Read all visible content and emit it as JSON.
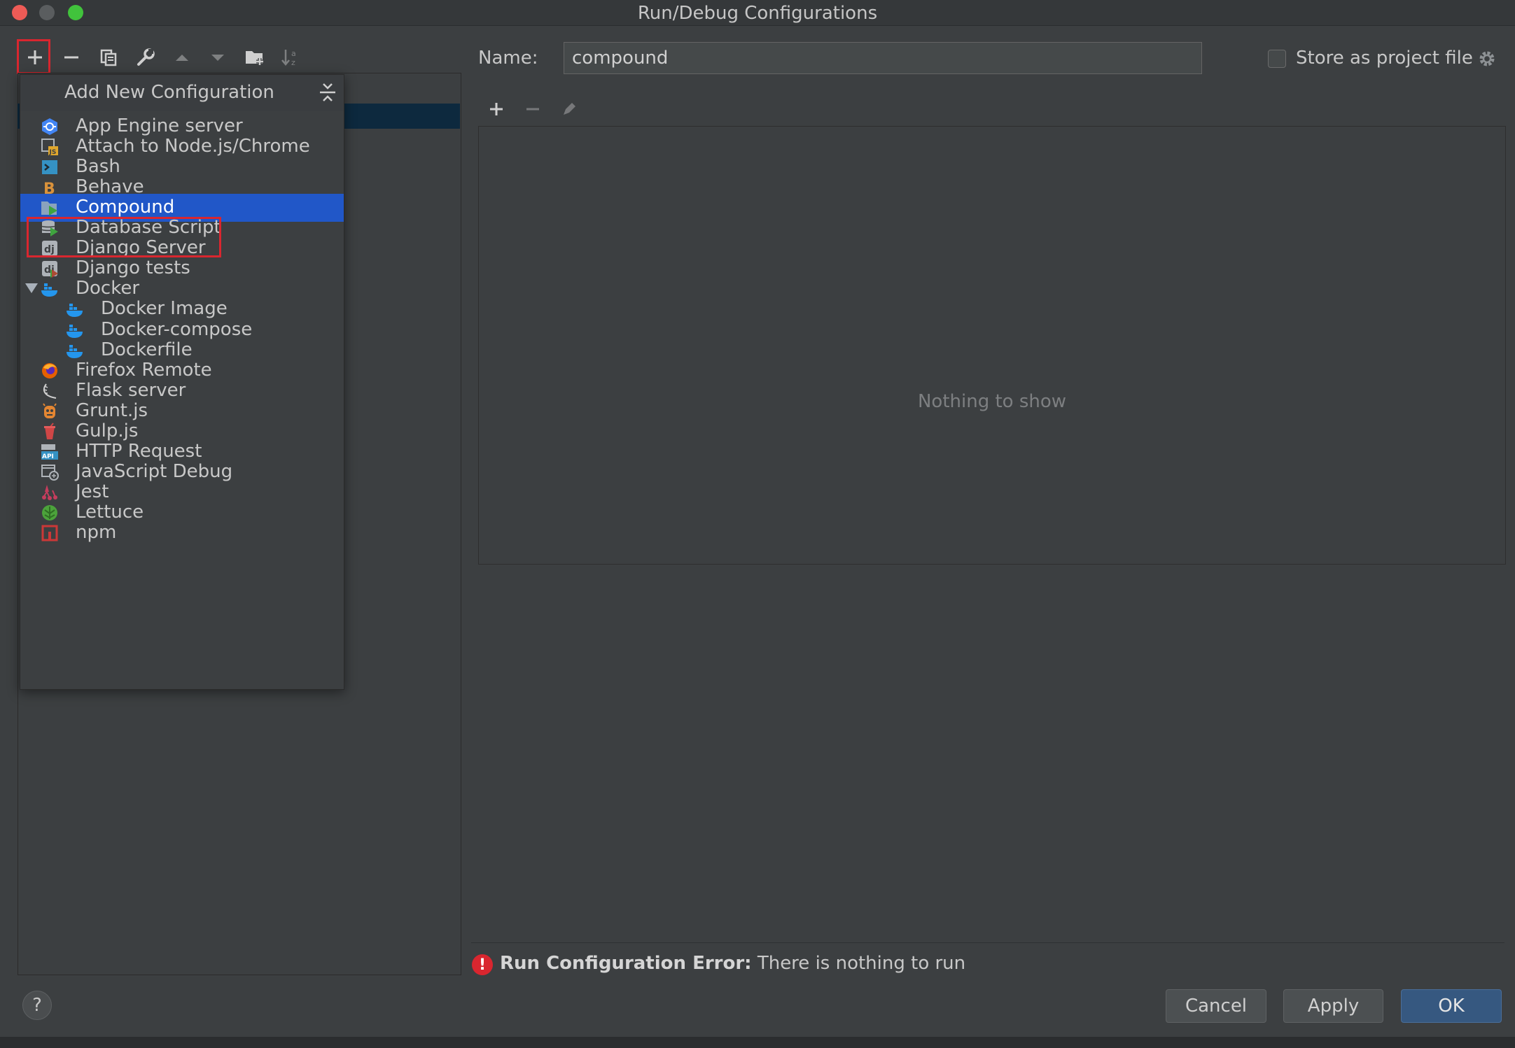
{
  "window": {
    "title": "Run/Debug Configurations"
  },
  "toolbar": {
    "icons": [
      "add-icon",
      "remove-icon",
      "copy-icon",
      "wrench-icon",
      "move-up-icon",
      "move-down-icon",
      "new-folder-icon",
      "sort-icon"
    ]
  },
  "popup": {
    "title": "Add New Configuration",
    "items": [
      {
        "label": "App Engine server",
        "icon": "app-engine-icon",
        "indent": 0
      },
      {
        "label": "Attach to Node.js/Chrome",
        "icon": "nodejs-attach-icon",
        "indent": 0
      },
      {
        "label": "Bash",
        "icon": "bash-icon",
        "indent": 0
      },
      {
        "label": "Behave",
        "icon": "behave-icon",
        "indent": 0
      },
      {
        "label": "Compound",
        "icon": "compound-icon",
        "indent": 0,
        "selected": true
      },
      {
        "label": "Database Script",
        "icon": "database-script-icon",
        "indent": 0
      },
      {
        "label": "Django Server",
        "icon": "django-icon",
        "indent": 0
      },
      {
        "label": "Django tests",
        "icon": "django-tests-icon",
        "indent": 0
      },
      {
        "label": "Docker",
        "icon": "docker-icon",
        "indent": 0,
        "expanded": true
      },
      {
        "label": "Docker Image",
        "icon": "docker-icon",
        "indent": 1
      },
      {
        "label": "Docker-compose",
        "icon": "docker-icon",
        "indent": 1
      },
      {
        "label": "Dockerfile",
        "icon": "docker-icon",
        "indent": 1
      },
      {
        "label": "Firefox Remote",
        "icon": "firefox-icon",
        "indent": 0
      },
      {
        "label": "Flask server",
        "icon": "flask-icon",
        "indent": 0
      },
      {
        "label": "Grunt.js",
        "icon": "grunt-icon",
        "indent": 0
      },
      {
        "label": "Gulp.js",
        "icon": "gulp-icon",
        "indent": 0
      },
      {
        "label": "HTTP Request",
        "icon": "http-request-icon",
        "indent": 0
      },
      {
        "label": "JavaScript Debug",
        "icon": "javascript-debug-icon",
        "indent": 0
      },
      {
        "label": "Jest",
        "icon": "jest-icon",
        "indent": 0
      },
      {
        "label": "Lettuce",
        "icon": "lettuce-icon",
        "indent": 0
      },
      {
        "label": "npm",
        "icon": "npm-icon",
        "indent": 0
      }
    ]
  },
  "form": {
    "name_label": "Name:",
    "name_value": "compound",
    "store_label": "Store as project file",
    "store_checked": false
  },
  "list": {
    "empty_text": "Nothing to show"
  },
  "error": {
    "title": "Run Configuration Error:",
    "message": "There is nothing to run"
  },
  "buttons": {
    "help": "?",
    "cancel": "Cancel",
    "apply": "Apply",
    "ok": "OK"
  },
  "colors": {
    "selection": "#2157c8",
    "highlight_box": "#d9262f",
    "ok_button": "#365880"
  }
}
